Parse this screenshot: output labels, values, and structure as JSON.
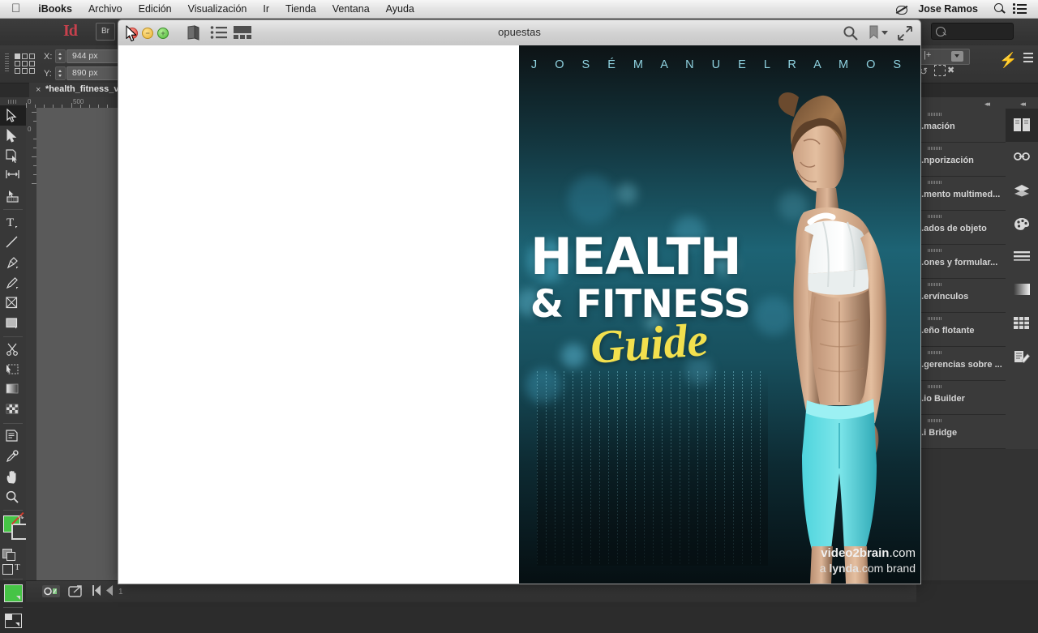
{
  "menubar": {
    "apple_icon": "apple-icon",
    "items": [
      {
        "label": "iBooks",
        "bold": true
      },
      {
        "label": "Archivo",
        "bold": false
      },
      {
        "label": "Edición",
        "bold": false
      },
      {
        "label": "Visualización",
        "bold": false
      },
      {
        "label": "Ir",
        "bold": false
      },
      {
        "label": "Tienda",
        "bold": false
      },
      {
        "label": "Ventana",
        "bold": false
      },
      {
        "label": "Ayuda",
        "bold": false
      }
    ],
    "status_items": [
      {
        "name": "do-not-disturb-icon",
        "label": ""
      },
      {
        "name": "user-name",
        "label": "Jose Ramos"
      },
      {
        "name": "spotlight-icon",
        "label": ""
      },
      {
        "name": "notification-center-icon",
        "label": ""
      }
    ]
  },
  "ibooks": {
    "title": "opuestas",
    "window_buttons": [
      {
        "name": "close-button",
        "glyph": "×"
      },
      {
        "name": "minimize-button",
        "glyph": "−"
      },
      {
        "name": "zoom-button",
        "glyph": "+"
      }
    ],
    "left_tools": [
      {
        "name": "library-book-icon",
        "label": "Biblioteca"
      },
      {
        "name": "table-of-contents-icon",
        "label": "Índice"
      },
      {
        "name": "thumbnails-grid-icon",
        "label": "Miniaturas"
      }
    ],
    "right_tools": [
      {
        "name": "search-icon",
        "label": "Buscar"
      },
      {
        "name": "bookmark-icon",
        "label": "Marcador"
      },
      {
        "name": "fullscreen-icon",
        "label": "Pantalla completa"
      }
    ]
  },
  "cover": {
    "author": "J O S É   M A N U E L   R A M O S",
    "title_line1": "HEALTH",
    "title_line2": "& FITNESS",
    "title_script": "Guide",
    "accent_yellow": "#f2e04e",
    "accent_cyan": "#8fd2e0",
    "watermark_line1_bold": "video2brain",
    "watermark_line1_rest": ".com",
    "watermark_line2_pre": "a ",
    "watermark_line2_bold": "lynda",
    "watermark_line2_rest": ".com brand"
  },
  "indesign": {
    "app_logo": "Id",
    "bridge_button": "Br",
    "search_placeholder": "",
    "document_tab": "*health_fitness_v",
    "tab_close": "×",
    "control_bar": {
      "x_label": "X:",
      "x_value": "944 px",
      "y_label": "Y:",
      "y_value": "890 px"
    },
    "ruler_h_labels": [
      "0",
      "500"
    ],
    "ruler_v_labels": [
      "0"
    ],
    "page_number": "1",
    "tools": [
      {
        "name": "selection-tool",
        "label": "Selección",
        "selected": true
      },
      {
        "name": "direct-selection-tool",
        "label": "Selección directa",
        "selected": false
      },
      {
        "name": "page-tool",
        "label": "Página",
        "selected": false
      },
      {
        "name": "gap-tool",
        "label": "Espacio",
        "selected": false
      },
      {
        "name": "content-collector-tool",
        "label": "Recopilador de contenido",
        "selected": false
      },
      {
        "name": "type-tool",
        "label": "Texto",
        "selected": false
      },
      {
        "name": "line-tool",
        "label": "Línea",
        "selected": false
      },
      {
        "name": "pen-tool",
        "label": "Pluma",
        "selected": false
      },
      {
        "name": "pencil-tool",
        "label": "Lápiz",
        "selected": false
      },
      {
        "name": "frame-tool",
        "label": "Marco rectangular",
        "selected": false
      },
      {
        "name": "rectangle-tool",
        "label": "Rectángulo",
        "selected": false
      },
      {
        "name": "scissors-tool",
        "label": "Tijeras",
        "selected": false
      },
      {
        "name": "free-transform-tool",
        "label": "Transformación libre",
        "selected": false
      },
      {
        "name": "gradient-swatch-tool",
        "label": "Muestra de degradado",
        "selected": false
      },
      {
        "name": "gradient-feather-tool",
        "label": "Degradado de desvanecimiento",
        "selected": false
      },
      {
        "name": "note-tool",
        "label": "Nota",
        "selected": false
      },
      {
        "name": "eyedropper-tool",
        "label": "Cuentagotas",
        "selected": false
      },
      {
        "name": "hand-tool",
        "label": "Mano",
        "selected": false
      },
      {
        "name": "zoom-tool",
        "label": "Zoom",
        "selected": false
      }
    ],
    "panel_tabs": [
      {
        "name": "panel-animacion",
        "label": "...mación"
      },
      {
        "name": "panel-temporizacion",
        "label": "...nporización"
      },
      {
        "name": "panel-elemento-multimedia",
        "label": "...mento multimed..."
      },
      {
        "name": "panel-estados-de-objeto",
        "label": "...ados de objeto"
      },
      {
        "name": "panel-botones-y-formularios",
        "label": "...ones y formular..."
      },
      {
        "name": "panel-hipervinculos",
        "label": "...ervínculos"
      },
      {
        "name": "panel-diseno-flotante",
        "label": "...eño flotante"
      },
      {
        "name": "panel-sugerencias",
        "label": "...gerencias sobre ..."
      },
      {
        "name": "panel-folio-builder",
        "label": "...io Builder"
      },
      {
        "name": "panel-mini-bridge",
        "label": "...i Bridge"
      }
    ],
    "dock_icons": [
      {
        "name": "pages-panel-icon",
        "label": "Páginas",
        "selected": true
      },
      {
        "name": "links-panel-icon",
        "label": "Vínculos",
        "selected": false
      },
      {
        "name": "layers-panel-icon",
        "label": "Capas",
        "selected": false
      },
      {
        "name": "swatches-panel-icon",
        "label": "Muestras",
        "selected": false
      },
      {
        "name": "stroke-panel-icon",
        "label": "Contorno",
        "selected": false
      },
      {
        "name": "gradient-panel-icon",
        "label": "Degradado",
        "selected": false
      },
      {
        "name": "table-panel-icon",
        "label": "Tabla",
        "selected": false
      },
      {
        "name": "styles-panel-icon",
        "label": "Estilos",
        "selected": false
      }
    ],
    "status_icons": [
      {
        "name": "preflight-icon",
        "label": "Comprobación preliminar"
      },
      {
        "name": "export-icon",
        "label": "Exportar"
      },
      {
        "name": "first-page-icon",
        "label": "Primera página"
      },
      {
        "name": "previous-page-icon",
        "label": "Página anterior"
      }
    ]
  }
}
